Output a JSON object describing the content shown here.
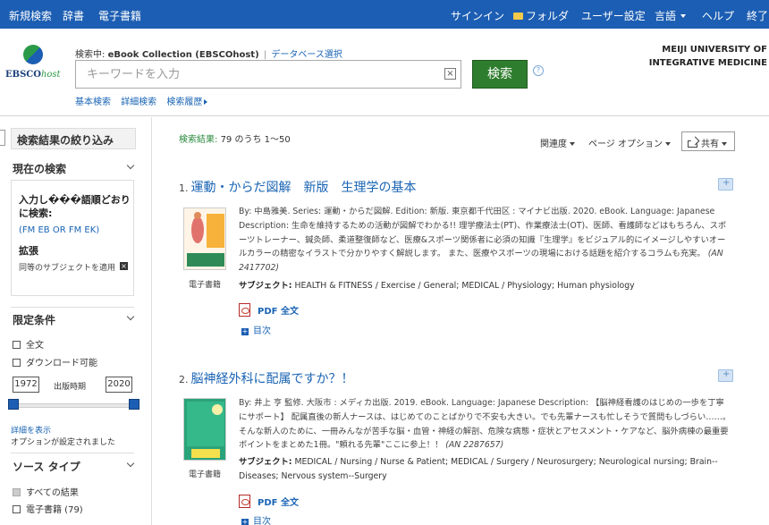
{
  "topnav": {
    "left": [
      "新規検索",
      "辞書",
      "電子書籍"
    ],
    "signin": "サインイン",
    "folder": "フォルダ",
    "prefs": "ユーザー設定",
    "language": "言語",
    "help": "ヘルプ",
    "exit": "終了"
  },
  "header": {
    "logo": {
      "main": "EBSCO",
      "sub": "host"
    },
    "searching_label": "検索中:",
    "database": "eBook Collection (EBSCOhost)",
    "choose_db": "データベース選択",
    "search_placeholder": "キーワードを入力",
    "search_button": "検索",
    "help_q": "?",
    "links": [
      "基本検索",
      "詳細検索",
      "検索履歴"
    ],
    "institution_line1": "MEIJI UNIVERSITY OF",
    "institution_line2": "INTEGRATIVE MEDICINE"
  },
  "sidebar": {
    "title": "検索結果の絞り込み",
    "current_search": {
      "heading": "現在の検索",
      "input_label": "入力し���語順どおりに検索:",
      "query": "(FM EB OR FM EK)",
      "expand_heading": "拡張",
      "equivalent": "同等のサブジェクトを適用"
    },
    "limiters": {
      "heading": "限定条件",
      "full_text": "全文",
      "downloadable": "ダウンロード可能",
      "year_from": "1972",
      "year_to": "2020",
      "date_label": "出版時期",
      "details_link": "詳細を表示",
      "options_set": "オプションが設定されました"
    },
    "source_types": {
      "heading": "ソース タイプ",
      "all": "すべての結果",
      "ebook": "電子書籍 (79)"
    }
  },
  "results_header": {
    "label": "検索結果:",
    "count_text": "79 のうち 1〜50",
    "sort": "関連度",
    "page_options": "ページ オプション",
    "share": "共有"
  },
  "results": [
    {
      "num": "1.",
      "title": "運動・からだ図解　新版　生理学の基本",
      "cover_text": "生理学",
      "type_label": "電子書籍",
      "desc": "By: 中島雅美. Series: 運動・からだ図解. Edition: 新版. 東京都千代田区 : マイナビ出版. 2020. eBook. Language: Japanese Description: 生命を維持するための活動が図解でわかる!! 理学療法士(PT)、作業療法士(OT)、医師、看護師などはもちろん、スポーツトレーナー、鍼灸師、柔道整復師など、医療&スポーツ関係者に必須の知識『生理学』をビジュアル的にイメージしやすいオールカラーの精密なイラストで分かりやすく解説します。 また、医療やスポーツの現場における話題を紹介するコラムも充実。",
      "an": "(AN 2417702)",
      "subject_label": "サブジェクト:",
      "subjects": "HEALTH & FITNESS / Exercise / General; MEDICAL / Physiology; Human physiology",
      "pdf": "PDF 全文",
      "toc": "目次"
    },
    {
      "num": "2.",
      "title": "脳神経外科に配属ですか？！",
      "cover_text": "脳神経外科配属",
      "type_label": "電子書籍",
      "desc": "By: 井上 亨 監修. 大阪市 : メディカ出版. 2019. eBook. Language: Japanese Description: 【脳神経看護のはじめの一歩を丁寧にサポート】 配属直後の新人ナースは、はじめてのことばかりで不安も大きい。でも先輩ナースも忙しそうで質問もしづらい……。そんな新人のために、一冊みんなが苦手な脳・血管・神経の解剖、危険な病態・症状とアセスメント・ケアなど、脳外病棟の最重要ポイントをまとめた1冊。\"頼れる先輩\"ここに参上！！",
      "an": "(AN 2287657)",
      "subject_label": "サブジェクト:",
      "subjects": "MEDICAL / Nursing / Nurse & Patient; MEDICAL / Surgery / Neurosurgery; Neurological nursing; Brain--Diseases; Nervous system--Surgery",
      "pdf": "PDF 全文",
      "toc": "目次"
    }
  ]
}
